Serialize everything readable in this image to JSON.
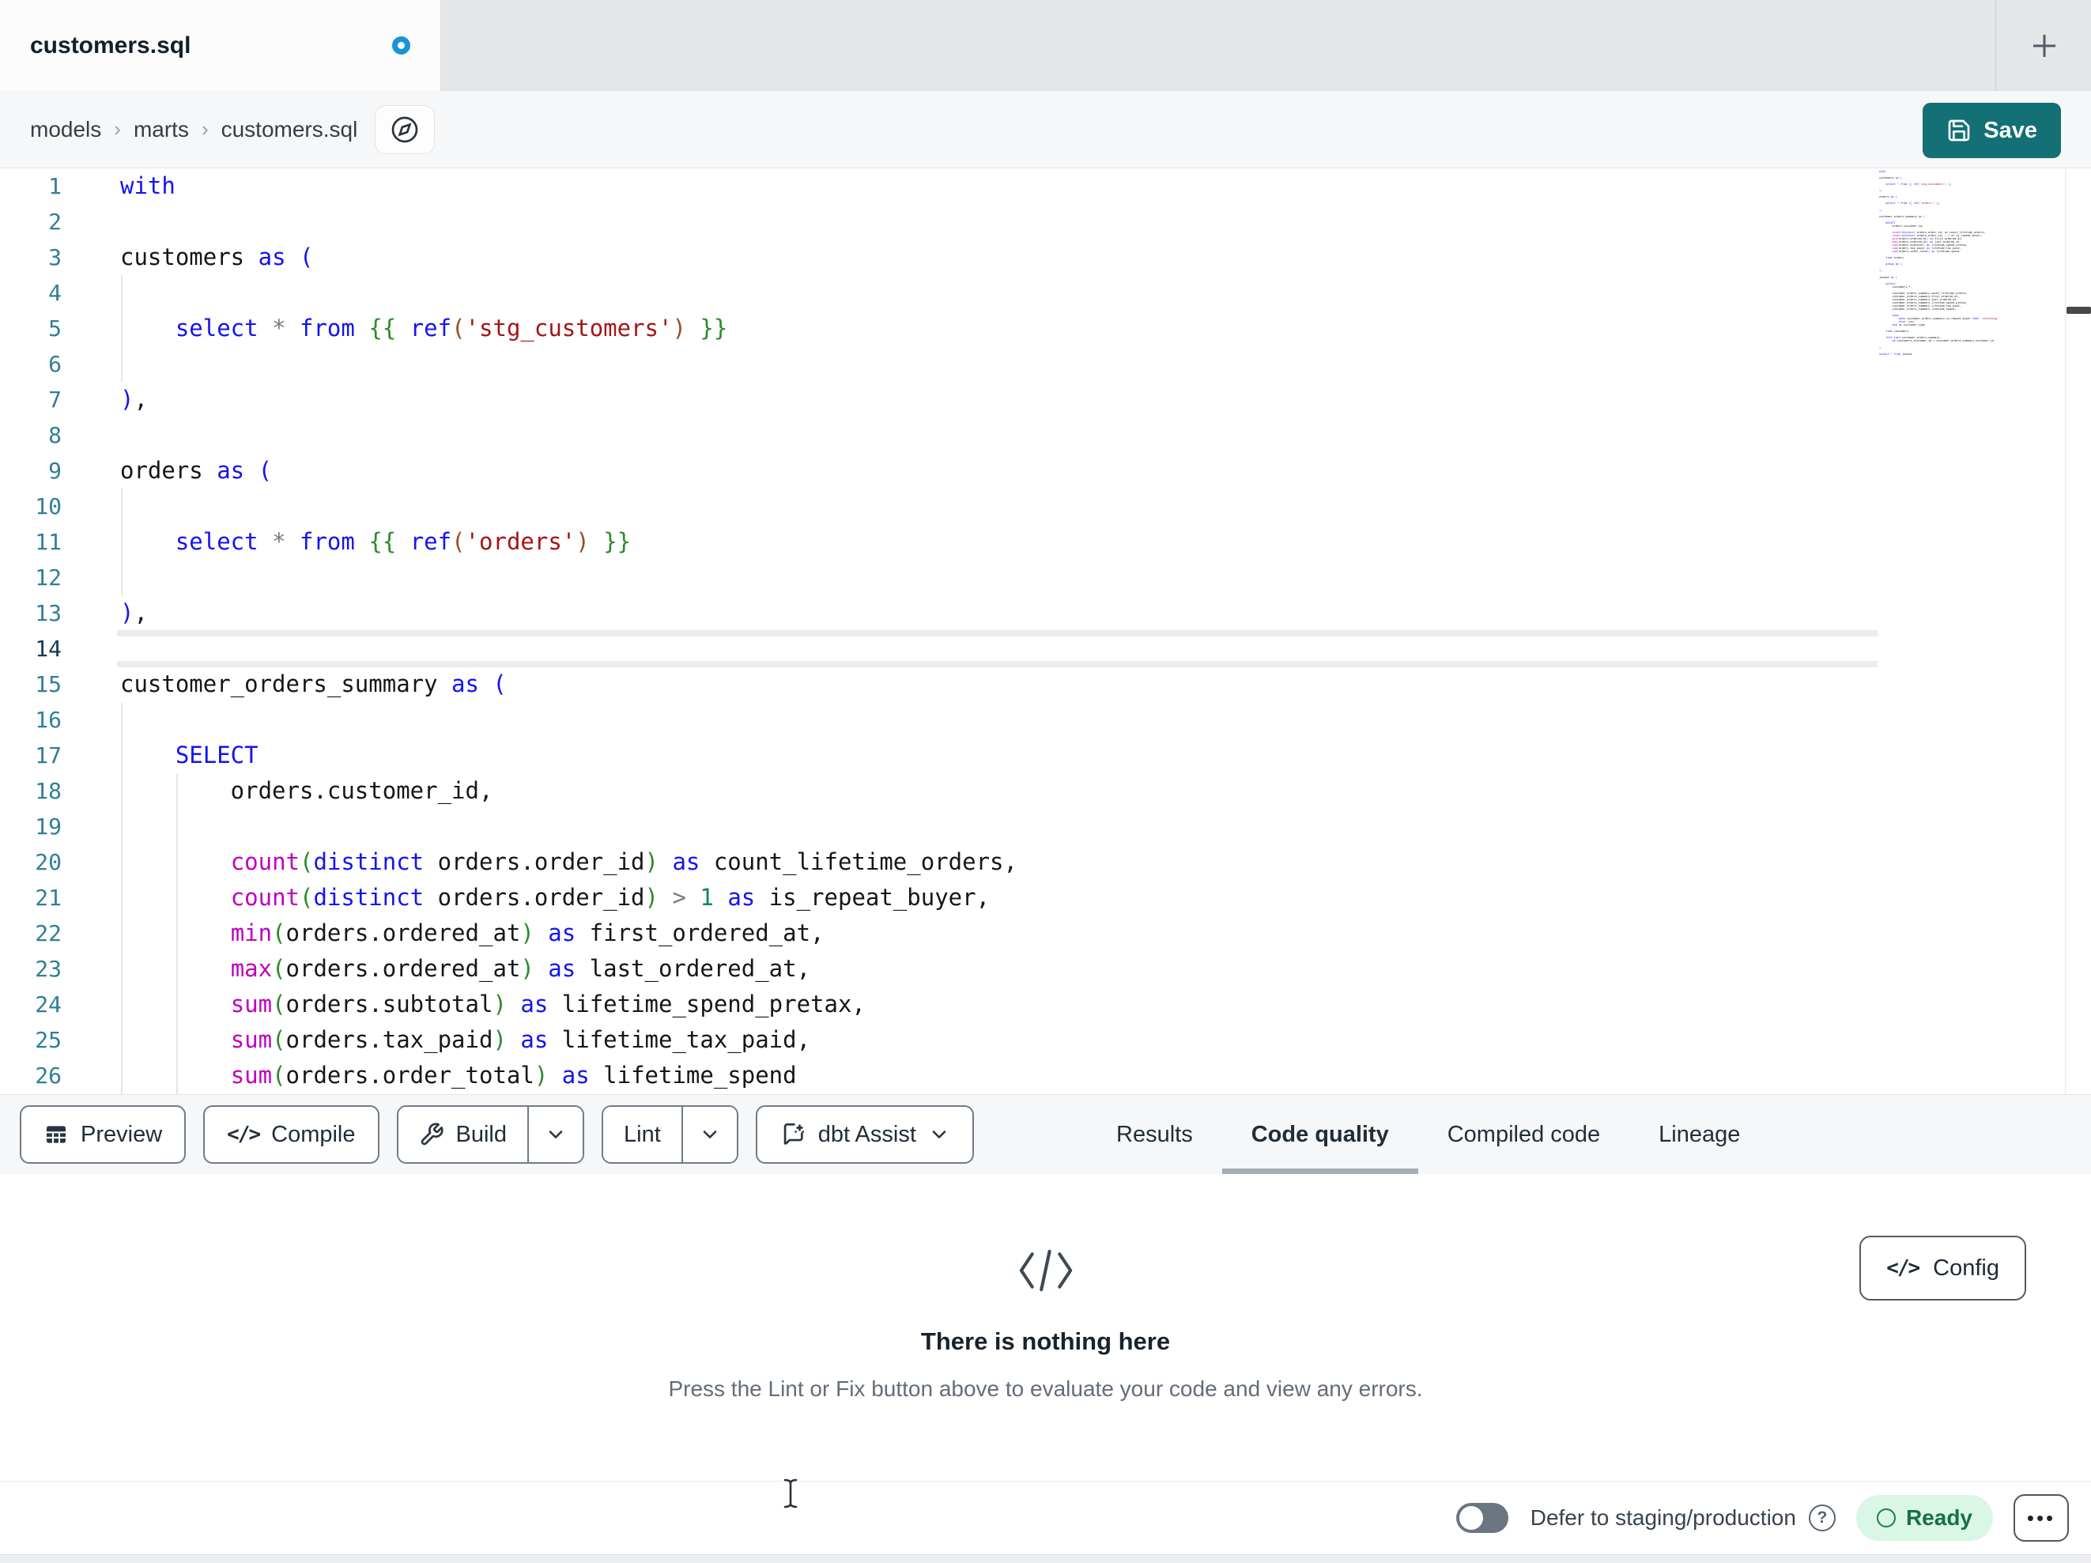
{
  "tab": {
    "title": "customers.sql"
  },
  "breadcrumb": {
    "items": [
      "models",
      "marts",
      "customers.sql"
    ]
  },
  "save_button": {
    "label": "Save"
  },
  "toolbar": {
    "preview_label": "Preview",
    "compile_label": "Compile",
    "build_label": "Build",
    "lint_label": "Lint",
    "dbt_assist_label": "dbt Assist"
  },
  "result_tabs": [
    {
      "label": "Results",
      "active": false
    },
    {
      "label": "Code quality",
      "active": true
    },
    {
      "label": "Compiled code",
      "active": false
    },
    {
      "label": "Lineage",
      "active": false
    }
  ],
  "empty_state": {
    "title": "There is nothing here",
    "description": "Press the Lint or Fix button above to evaluate your code and view any errors.",
    "config_label": "Config"
  },
  "status_bar": {
    "defer_label": "Defer to staging/production",
    "ready_label": "Ready"
  },
  "colors": {
    "accent_teal": "#137074",
    "unsaved_dot": "#1795d6",
    "ready_bg": "#d9f6e6",
    "ready_text": "#156f4b"
  },
  "editor": {
    "active_line": 14,
    "lines": [
      [
        [
          "kw",
          "with"
        ]
      ],
      [],
      [
        [
          "pl",
          "customers "
        ],
        [
          "kw",
          "as ("
        ]
      ],
      [],
      [
        [
          "pl",
          "    "
        ],
        [
          "kw",
          "select"
        ],
        [
          "pl",
          " "
        ],
        [
          "op",
          "*"
        ],
        [
          "pl",
          " "
        ],
        [
          "kw",
          "from"
        ],
        [
          "pl",
          " "
        ],
        [
          "jinja",
          "{{"
        ],
        [
          "pl",
          " "
        ],
        [
          "kw",
          "ref"
        ],
        [
          "pb",
          "("
        ],
        [
          "str",
          "'stg_customers'"
        ],
        [
          "pb",
          ")"
        ],
        [
          "pl",
          " "
        ],
        [
          "jinja",
          "}}"
        ]
      ],
      [],
      [
        [
          "kw",
          ")"
        ],
        [
          "pl",
          ","
        ]
      ],
      [],
      [
        [
          "pl",
          "orders "
        ],
        [
          "kw",
          "as ("
        ]
      ],
      [],
      [
        [
          "pl",
          "    "
        ],
        [
          "kw",
          "select"
        ],
        [
          "pl",
          " "
        ],
        [
          "op",
          "*"
        ],
        [
          "pl",
          " "
        ],
        [
          "kw",
          "from"
        ],
        [
          "pl",
          " "
        ],
        [
          "jinja",
          "{{"
        ],
        [
          "pl",
          " "
        ],
        [
          "kw",
          "ref"
        ],
        [
          "pb",
          "("
        ],
        [
          "str",
          "'orders'"
        ],
        [
          "pb",
          ")"
        ],
        [
          "pl",
          " "
        ],
        [
          "jinja",
          "}}"
        ]
      ],
      [],
      [
        [
          "kw",
          ")"
        ],
        [
          "pl",
          ","
        ]
      ],
      [],
      [
        [
          "pl",
          "customer_orders_summary "
        ],
        [
          "kw",
          "as ("
        ]
      ],
      [],
      [
        [
          "pl",
          "    "
        ],
        [
          "kw",
          "SELECT"
        ]
      ],
      [
        [
          "pl",
          "        orders.customer_id,"
        ]
      ],
      [],
      [
        [
          "pl",
          "        "
        ],
        [
          "fn",
          "count"
        ],
        [
          "pg",
          "("
        ],
        [
          "kw",
          "distinct"
        ],
        [
          "pl",
          " orders.order_id"
        ],
        [
          "pg",
          ")"
        ],
        [
          "pl",
          " "
        ],
        [
          "kw",
          "as"
        ],
        [
          "pl",
          " count_lifetime_orders,"
        ]
      ],
      [
        [
          "pl",
          "        "
        ],
        [
          "fn",
          "count"
        ],
        [
          "pg",
          "("
        ],
        [
          "kw",
          "distinct"
        ],
        [
          "pl",
          " orders.order_id"
        ],
        [
          "pg",
          ")"
        ],
        [
          "pl",
          " "
        ],
        [
          "op",
          ">"
        ],
        [
          "pl",
          " "
        ],
        [
          "num",
          "1"
        ],
        [
          "pl",
          " "
        ],
        [
          "kw",
          "as"
        ],
        [
          "pl",
          " is_repeat_buyer,"
        ]
      ],
      [
        [
          "pl",
          "        "
        ],
        [
          "fn",
          "min"
        ],
        [
          "pg",
          "("
        ],
        [
          "pl",
          "orders.ordered_at"
        ],
        [
          "pg",
          ")"
        ],
        [
          "pl",
          " "
        ],
        [
          "kw",
          "as"
        ],
        [
          "pl",
          " first_ordered_at,"
        ]
      ],
      [
        [
          "pl",
          "        "
        ],
        [
          "fn",
          "max"
        ],
        [
          "pg",
          "("
        ],
        [
          "pl",
          "orders.ordered_at"
        ],
        [
          "pg",
          ")"
        ],
        [
          "pl",
          " "
        ],
        [
          "kw",
          "as"
        ],
        [
          "pl",
          " last_ordered_at,"
        ]
      ],
      [
        [
          "pl",
          "        "
        ],
        [
          "fn",
          "sum"
        ],
        [
          "pg",
          "("
        ],
        [
          "pl",
          "orders.subtotal"
        ],
        [
          "pg",
          ")"
        ],
        [
          "pl",
          " "
        ],
        [
          "kw",
          "as"
        ],
        [
          "pl",
          " lifetime_spend_pretax,"
        ]
      ],
      [
        [
          "pl",
          "        "
        ],
        [
          "fn",
          "sum"
        ],
        [
          "pg",
          "("
        ],
        [
          "pl",
          "orders.tax_paid"
        ],
        [
          "pg",
          ")"
        ],
        [
          "pl",
          " "
        ],
        [
          "kw",
          "as"
        ],
        [
          "pl",
          " lifetime_tax_paid,"
        ]
      ],
      [
        [
          "pl",
          "        "
        ],
        [
          "fn",
          "sum"
        ],
        [
          "pg",
          "("
        ],
        [
          "pl",
          "orders.order_total"
        ],
        [
          "pg",
          ")"
        ],
        [
          "pl",
          " "
        ],
        [
          "kw",
          "as"
        ],
        [
          "pl",
          " lifetime_spend"
        ]
      ]
    ],
    "minimap_extra_lines": [
      [],
      [
        [
          "pl",
          "    "
        ],
        [
          "kw",
          "from"
        ],
        [
          "pl",
          " orders"
        ]
      ],
      [],
      [
        [
          "pl",
          "    "
        ],
        [
          "kw",
          "group by"
        ],
        [
          "pl",
          " "
        ],
        [
          "num",
          "1"
        ]
      ],
      [],
      [
        [
          "kw",
          ")"
        ],
        [
          "pl",
          ","
        ]
      ],
      [],
      [
        [
          "pl",
          "joined "
        ],
        [
          "kw",
          "as ("
        ]
      ],
      [],
      [
        [
          "pl",
          "    "
        ],
        [
          "kw",
          "select"
        ]
      ],
      [
        [
          "pl",
          "        customers.*,"
        ]
      ],
      [],
      [
        [
          "pl",
          "        customer_orders_summary.count_lifetime_orders,"
        ]
      ],
      [
        [
          "pl",
          "        customer_orders_summary.first_ordered_at,"
        ]
      ],
      [
        [
          "pl",
          "        customer_orders_summary.last_ordered_at,"
        ]
      ],
      [
        [
          "pl",
          "        customer_orders_summary.lifetime_spend_pretax,"
        ]
      ],
      [
        [
          "pl",
          "        customer_orders_summary.lifetime_tax_paid,"
        ]
      ],
      [
        [
          "pl",
          "        customer_orders_summary.lifetime_spend,"
        ]
      ],
      [],
      [
        [
          "pl",
          "        "
        ],
        [
          "kw",
          "case"
        ]
      ],
      [
        [
          "pl",
          "            "
        ],
        [
          "kw",
          "when"
        ],
        [
          "pl",
          " customer_orders_summary.is_repeat_buyer "
        ],
        [
          "kw",
          "then"
        ],
        [
          "pl",
          " "
        ],
        [
          "str",
          "'returning'"
        ]
      ],
      [
        [
          "pl",
          "            "
        ],
        [
          "kw",
          "else"
        ],
        [
          "pl",
          " "
        ],
        [
          "str",
          "'new'"
        ]
      ],
      [
        [
          "pl",
          "        "
        ],
        [
          "kw",
          "end"
        ],
        [
          "pl",
          " "
        ],
        [
          "kw",
          "as"
        ],
        [
          "pl",
          " customer_type"
        ]
      ],
      [],
      [
        [
          "pl",
          "    "
        ],
        [
          "kw",
          "from"
        ],
        [
          "pl",
          " customers"
        ]
      ],
      [],
      [
        [
          "pl",
          "    "
        ],
        [
          "kw",
          "left join"
        ],
        [
          "pl",
          " customer_orders_summary"
        ]
      ],
      [
        [
          "pl",
          "        "
        ],
        [
          "kw",
          "on"
        ],
        [
          "pl",
          " customers.customer_id = customer_orders_summary.customer_id"
        ]
      ],
      [],
      [
        [
          "kw",
          ")"
        ]
      ],
      [],
      [
        [
          "kw",
          "select"
        ],
        [
          "pl",
          " "
        ],
        [
          "op",
          "*"
        ],
        [
          "pl",
          " "
        ],
        [
          "kw",
          "from"
        ],
        [
          "pl",
          " joined"
        ]
      ]
    ]
  }
}
